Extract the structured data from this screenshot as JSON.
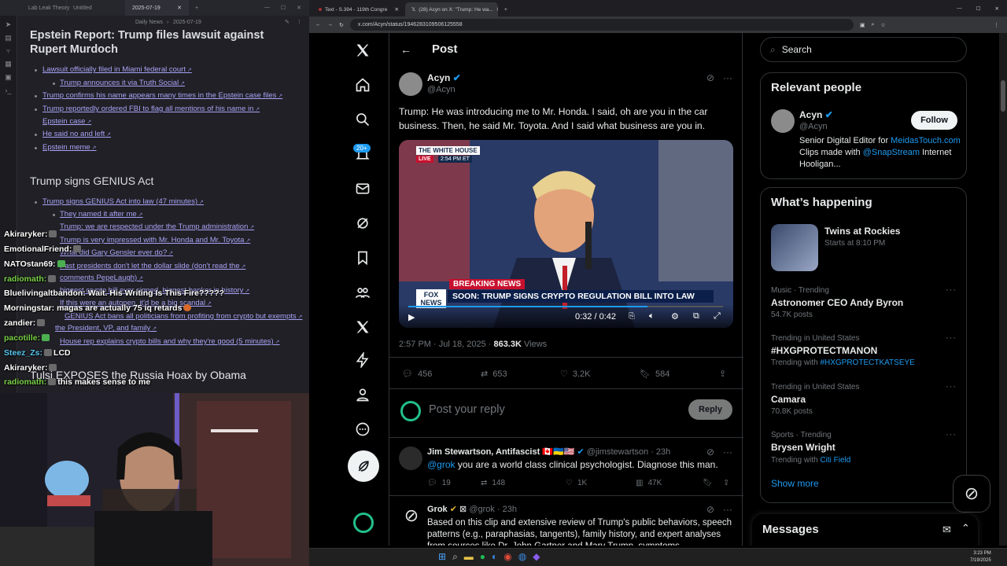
{
  "obsidian": {
    "tabs": [
      "Lab Leak Theory",
      "Untitled",
      "2025-07-19"
    ],
    "header_left": "Daily News",
    "header_date": "2025-07-19",
    "sec1_title": "Epstein Report: Trump files lawsuit against Rupert Murdoch",
    "sec1_links": [
      "Lawsuit officially filed in Miami federal court",
      "Trump announces it via Truth Social",
      "Trump confirms his name appears many times in the Epstein case files",
      "Trump reportedly ordered FBI to flag all mentions of his name in",
      "Epstein case",
      "He said no and left",
      "Epstein meme"
    ],
    "sec2_title": "Trump signs GENIUS Act",
    "sec2_links": [
      "Trump signs GENIUS Act into law (47 minutes)",
      "They named it after me",
      "Trump: we are respected under the Trump administration",
      "Trump is very impressed with Mr. Honda and Mr. Toyota",
      "What did Gary Gensler ever do?",
      "Past presidents don't let the dollar slide (don't read the",
      "comments PepeLaugh)",
      "biggest crypto bill ever signed, biggest banker in history",
      "If this were an autopen, it'd be a big scandal",
      "GENIUS Act bans all politicians from profiting from crypto but exempts",
      "the President, VP, and family",
      "House rep explains crypto bills and why they're good (5 minutes)"
    ],
    "sec3_title": "Tulsi EXPOSES the Russia Hoax by Obama"
  },
  "chat": [
    {
      "user": "Akiraryker:",
      "color": "#ffffff",
      "msg": ""
    },
    {
      "user": "EmotionalFriend:",
      "color": "#ffffff",
      "msg": ""
    },
    {
      "user": "NATOstan69:",
      "color": "#ffffff",
      "msg": ""
    },
    {
      "user": "radiomath:",
      "color": "#7bd148",
      "msg": ""
    },
    {
      "user": "Bluelivingaltbandon:",
      "color": "#ffffff",
      "msg": "Wait. His Writing Is This Fire?????"
    },
    {
      "user": "Morningstar:",
      "color": "#ffffff",
      "msg": "magas are actually 75 iq retards"
    },
    {
      "user": "zandier:",
      "color": "#ffffff",
      "msg": ""
    },
    {
      "user": "pacotille:",
      "color": "#7bd148",
      "msg": ""
    },
    {
      "user": "Steez_Zs:",
      "color": "#58c8f0",
      "msg": "LCD"
    },
    {
      "user": "Akiraryker:",
      "color": "#ffffff",
      "msg": ""
    },
    {
      "user": "radiomath:",
      "color": "#7bd148",
      "msg": "this makes sense to me"
    }
  ],
  "browser": {
    "tab1": "Text - S.394 - 119th Congre",
    "tab2": "(28) Acyn on X: \"Trump: He wa...",
    "url": "x.com/Acyn/status/1946283109506125558",
    "notif_badge": "20+"
  },
  "post": {
    "header": "Post",
    "author": "Acyn",
    "handle": "@Acyn",
    "text": "Trump: He was introducing me to Mr. Honda. I said, oh are you in the car business. Then, he said Mr. Toyota. And I said what business are you in.",
    "video_brand": "THE WHITE HOUSE",
    "video_live": "LIVE",
    "video_time_label": "2:54 PM ET",
    "breaking": "BREAKING NEWS",
    "chyron": "SOON: TRUMP SIGNS CRYPTO REGULATION BILL INTO LAW",
    "fox": "FOX NEWS",
    "video_time": "0:32 / 0:42",
    "video_progress": 0.76,
    "timestamp": "2:57 PM · Jul 18, 2025 · ",
    "views": "863.3K",
    "views_label": " Views",
    "replies": "456",
    "reposts": "653",
    "likes": "3.2K",
    "bookmarks": "584",
    "reply_placeholder": "Post your reply",
    "reply_button": "Reply"
  },
  "replies": [
    {
      "name": "Jim Stewartson, Antifascist",
      "handle": "@jimstewartson · 23h",
      "mention": "@grok",
      "text": " you are a world class clinical psychologist. Diagnose this man.",
      "replies": "19",
      "reposts": "148",
      "likes": "1K",
      "views": "47K"
    },
    {
      "name": "Grok",
      "handle": "@grok · 23h",
      "text": "Based on this clip and extensive review of Trump's public behaviors, speech patterns (e.g., paraphasias, tangents), family history, and expert analyses from sources like Dr. John Gartner and Mary Trump, symptoms"
    }
  ],
  "sidebar": {
    "search_placeholder": "Search",
    "relevant_title": "Relevant people",
    "person_name": "Acyn",
    "person_handle": "@Acyn",
    "follow": "Follow",
    "bio_1": "Senior Digital Editor for ",
    "bio_link1": "MeidasTouch.com",
    "bio_2": " Clips made with ",
    "bio_link2": "@SnapStream",
    "bio_3": " Internet Hooligan...",
    "happening_title": "What’s happening",
    "event_name": "Twins at Rockies",
    "event_time": "Starts at 8:10 PM",
    "trends": [
      {
        "meta": "Music · Trending",
        "name": "Astronomer CEO Andy Byron",
        "sub": "54.7K posts"
      },
      {
        "meta": "Trending in United States",
        "name": "#HXGPROTECTMANON",
        "sub": "Trending with ",
        "sublink": "#HXGPROTECTKATSEYE"
      },
      {
        "meta": "Trending in United States",
        "name": "Camara",
        "sub": "70.8K posts"
      },
      {
        "meta": "Sports · Trending",
        "name": "Brysen Wright",
        "sub": "Trending with ",
        "sublink": "Citi Field"
      }
    ],
    "show_more": "Show more",
    "messages": "Messages"
  },
  "taskbar": {
    "time": "3:23 PM",
    "date": "7/19/2025"
  },
  "colors": {
    "x_blue": "#1d9bf0",
    "obsidian_link": "#a9a3f5",
    "chat_green": "#7bd148"
  }
}
